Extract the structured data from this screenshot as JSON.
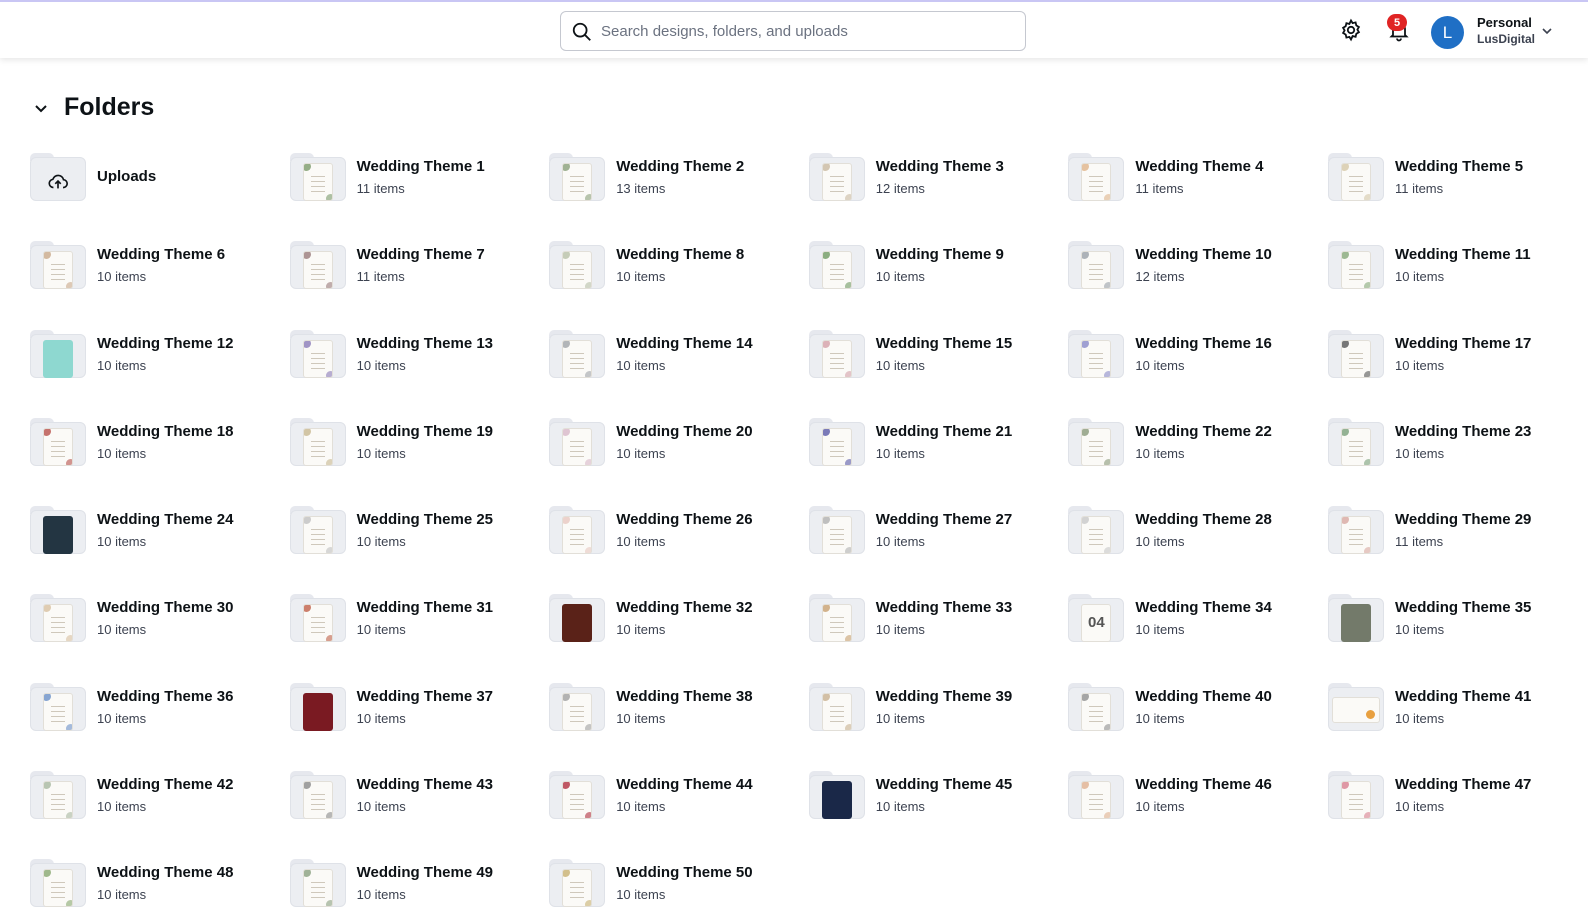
{
  "search": {
    "placeholder": "Search designs, folders, and uploads"
  },
  "notifications": {
    "count": "5"
  },
  "account": {
    "initial": "L",
    "name": "Personal",
    "team": "LusDigital"
  },
  "section": {
    "title": "Folders"
  },
  "folders": [
    {
      "title": "Uploads",
      "count": "",
      "thumb": "cloud-icon",
      "accent": ""
    },
    {
      "title": "Wedding Theme 1",
      "count": "11 items",
      "thumb": "invitation",
      "accent": "#7a9a6a"
    },
    {
      "title": "Wedding Theme 2",
      "count": "13 items",
      "thumb": "invitation",
      "accent": "#8aa07a"
    },
    {
      "title": "Wedding Theme 3",
      "count": "12 items",
      "thumb": "invitation",
      "accent": "#c9b9a0"
    },
    {
      "title": "Wedding Theme 4",
      "count": "11 items",
      "thumb": "invitation",
      "accent": "#e0b48a"
    },
    {
      "title": "Wedding Theme 5",
      "count": "11 items",
      "thumb": "invitation",
      "accent": "#d6c8a8"
    },
    {
      "title": "Wedding Theme 6",
      "count": "10 items",
      "thumb": "invitation",
      "accent": "#c9a98a"
    },
    {
      "title": "Wedding Theme 7",
      "count": "11 items",
      "thumb": "invitation",
      "accent": "#9a7a7a"
    },
    {
      "title": "Wedding Theme 8",
      "count": "10 items",
      "thumb": "invitation",
      "accent": "#b8c0a8"
    },
    {
      "title": "Wedding Theme 9",
      "count": "10 items",
      "thumb": "invitation",
      "accent": "#6f9a62"
    },
    {
      "title": "Wedding Theme 10",
      "count": "12 items",
      "thumb": "invitation",
      "accent": "#9aa0a8"
    },
    {
      "title": "Wedding Theme 11",
      "count": "10 items",
      "thumb": "invitation",
      "accent": "#86a878"
    },
    {
      "title": "Wedding Theme 12",
      "count": "10 items",
      "thumb": "invitation-filled",
      "accent": "#8ed8d0"
    },
    {
      "title": "Wedding Theme 13",
      "count": "10 items",
      "thumb": "invitation",
      "accent": "#8a7ab8"
    },
    {
      "title": "Wedding Theme 14",
      "count": "10 items",
      "thumb": "invitation",
      "accent": "#a0a4a8"
    },
    {
      "title": "Wedding Theme 15",
      "count": "10 items",
      "thumb": "invitation",
      "accent": "#d4a0a8"
    },
    {
      "title": "Wedding Theme 16",
      "count": "10 items",
      "thumb": "invitation",
      "accent": "#8a8ac8"
    },
    {
      "title": "Wedding Theme 17",
      "count": "10 items",
      "thumb": "invitation",
      "accent": "#555555"
    },
    {
      "title": "Wedding Theme 18",
      "count": "10 items",
      "thumb": "invitation",
      "accent": "#b8504a"
    },
    {
      "title": "Wedding Theme 19",
      "count": "10 items",
      "thumb": "invitation",
      "accent": "#c8b890"
    },
    {
      "title": "Wedding Theme 20",
      "count": "10 items",
      "thumb": "invitation",
      "accent": "#d8b8c8"
    },
    {
      "title": "Wedding Theme 21",
      "count": "10 items",
      "thumb": "invitation",
      "accent": "#5a5aa8"
    },
    {
      "title": "Wedding Theme 22",
      "count": "10 items",
      "thumb": "invitation",
      "accent": "#8a9a7a"
    },
    {
      "title": "Wedding Theme 23",
      "count": "10 items",
      "thumb": "invitation",
      "accent": "#7aa07a"
    },
    {
      "title": "Wedding Theme 24",
      "count": "10 items",
      "thumb": "invitation-filled",
      "accent": "#233542"
    },
    {
      "title": "Wedding Theme 25",
      "count": "10 items",
      "thumb": "invitation",
      "accent": "#c0c0c0"
    },
    {
      "title": "Wedding Theme 26",
      "count": "10 items",
      "thumb": "invitation",
      "accent": "#e8c8c0"
    },
    {
      "title": "Wedding Theme 27",
      "count": "10 items",
      "thumb": "invitation",
      "accent": "#b0b0b0"
    },
    {
      "title": "Wedding Theme 28",
      "count": "10 items",
      "thumb": "invitation",
      "accent": "#c8c8c8"
    },
    {
      "title": "Wedding Theme 29",
      "count": "11 items",
      "thumb": "invitation",
      "accent": "#d8a8a0"
    },
    {
      "title": "Wedding Theme 30",
      "count": "10 items",
      "thumb": "invitation",
      "accent": "#d8c0a0"
    },
    {
      "title": "Wedding Theme 31",
      "count": "10 items",
      "thumb": "invitation",
      "accent": "#c06048"
    },
    {
      "title": "Wedding Theme 32",
      "count": "10 items",
      "thumb": "invitation-filled",
      "accent": "#5a2218"
    },
    {
      "title": "Wedding Theme 33",
      "count": "10 items",
      "thumb": "invitation",
      "accent": "#c8a070"
    },
    {
      "title": "Wedding Theme 34",
      "count": "10 items",
      "thumb": "invitation-number",
      "accent": "#555555"
    },
    {
      "title": "Wedding Theme 35",
      "count": "10 items",
      "thumb": "invitation-filled",
      "accent": "#737a6a"
    },
    {
      "title": "Wedding Theme 36",
      "count": "10 items",
      "thumb": "invitation",
      "accent": "#6a90c8"
    },
    {
      "title": "Wedding Theme 37",
      "count": "10 items",
      "thumb": "invitation-filled",
      "accent": "#7a1a22"
    },
    {
      "title": "Wedding Theme 38",
      "count": "10 items",
      "thumb": "invitation",
      "accent": "#a0a0a0"
    },
    {
      "title": "Wedding Theme 39",
      "count": "10 items",
      "thumb": "invitation",
      "accent": "#c8b090"
    },
    {
      "title": "Wedding Theme 40",
      "count": "10 items",
      "thumb": "invitation",
      "accent": "#909090"
    },
    {
      "title": "Wedding Theme 41",
      "count": "10 items",
      "thumb": "invitation-wide",
      "accent": "#e8a040"
    },
    {
      "title": "Wedding Theme 42",
      "count": "10 items",
      "thumb": "invitation",
      "accent": "#a8b8a0"
    },
    {
      "title": "Wedding Theme 43",
      "count": "10 items",
      "thumb": "invitation",
      "accent": "#8a8a8a"
    },
    {
      "title": "Wedding Theme 44",
      "count": "10 items",
      "thumb": "invitation",
      "accent": "#b03040"
    },
    {
      "title": "Wedding Theme 45",
      "count": "10 items",
      "thumb": "invitation-filled",
      "accent": "#1a2848"
    },
    {
      "title": "Wedding Theme 46",
      "count": "10 items",
      "thumb": "invitation",
      "accent": "#e0b090"
    },
    {
      "title": "Wedding Theme 47",
      "count": "10 items",
      "thumb": "invitation",
      "accent": "#d88090"
    },
    {
      "title": "Wedding Theme 48",
      "count": "10 items",
      "thumb": "invitation",
      "accent": "#88a870"
    },
    {
      "title": "Wedding Theme 49",
      "count": "10 items",
      "thumb": "invitation",
      "accent": "#8aa080"
    },
    {
      "title": "Wedding Theme 50",
      "count": "10 items",
      "thumb": "invitation",
      "accent": "#c8b070"
    }
  ]
}
